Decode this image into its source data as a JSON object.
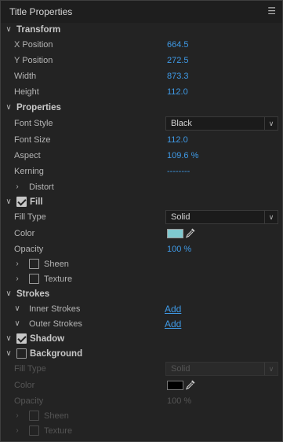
{
  "panel": {
    "title": "Title Properties",
    "menu_icon": "hamburger-icon"
  },
  "transform": {
    "title": "Transform",
    "x_label": "X Position",
    "x_value": "664.5",
    "y_label": "Y Position",
    "y_value": "272.5",
    "width_label": "Width",
    "width_value": "873.3",
    "height_label": "Height",
    "height_value": "112.0"
  },
  "properties": {
    "title": "Properties",
    "font_style_label": "Font Style",
    "font_style_value": "Black",
    "font_size_label": "Font Size",
    "font_size_value": "112.0",
    "aspect_label": "Aspect",
    "aspect_value": "109.6 %",
    "kerning_label": "Kerning",
    "kerning_value": "--------",
    "distort_label": "Distort"
  },
  "fill": {
    "title": "Fill",
    "checked": true,
    "fill_type_label": "Fill Type",
    "fill_type_value": "Solid",
    "color_label": "Color",
    "color_value": "#7fc9cf",
    "opacity_label": "Opacity",
    "opacity_value": "100 %",
    "sheen_label": "Sheen",
    "texture_label": "Texture"
  },
  "strokes": {
    "title": "Strokes",
    "inner_label": "Inner Strokes",
    "inner_add": "Add",
    "outer_label": "Outer Strokes",
    "outer_add": "Add"
  },
  "shadow": {
    "title": "Shadow",
    "checked": true
  },
  "background": {
    "title": "Background",
    "checked": false,
    "fill_type_label": "Fill Type",
    "fill_type_value": "Solid",
    "color_label": "Color",
    "color_value": "#000000",
    "opacity_label": "Opacity",
    "opacity_value": "100 %",
    "sheen_label": "Sheen",
    "texture_label": "Texture"
  },
  "colors": {
    "accent": "#3f9ae6",
    "panel_bg": "#232323",
    "header_bg": "#1e1e1e"
  }
}
